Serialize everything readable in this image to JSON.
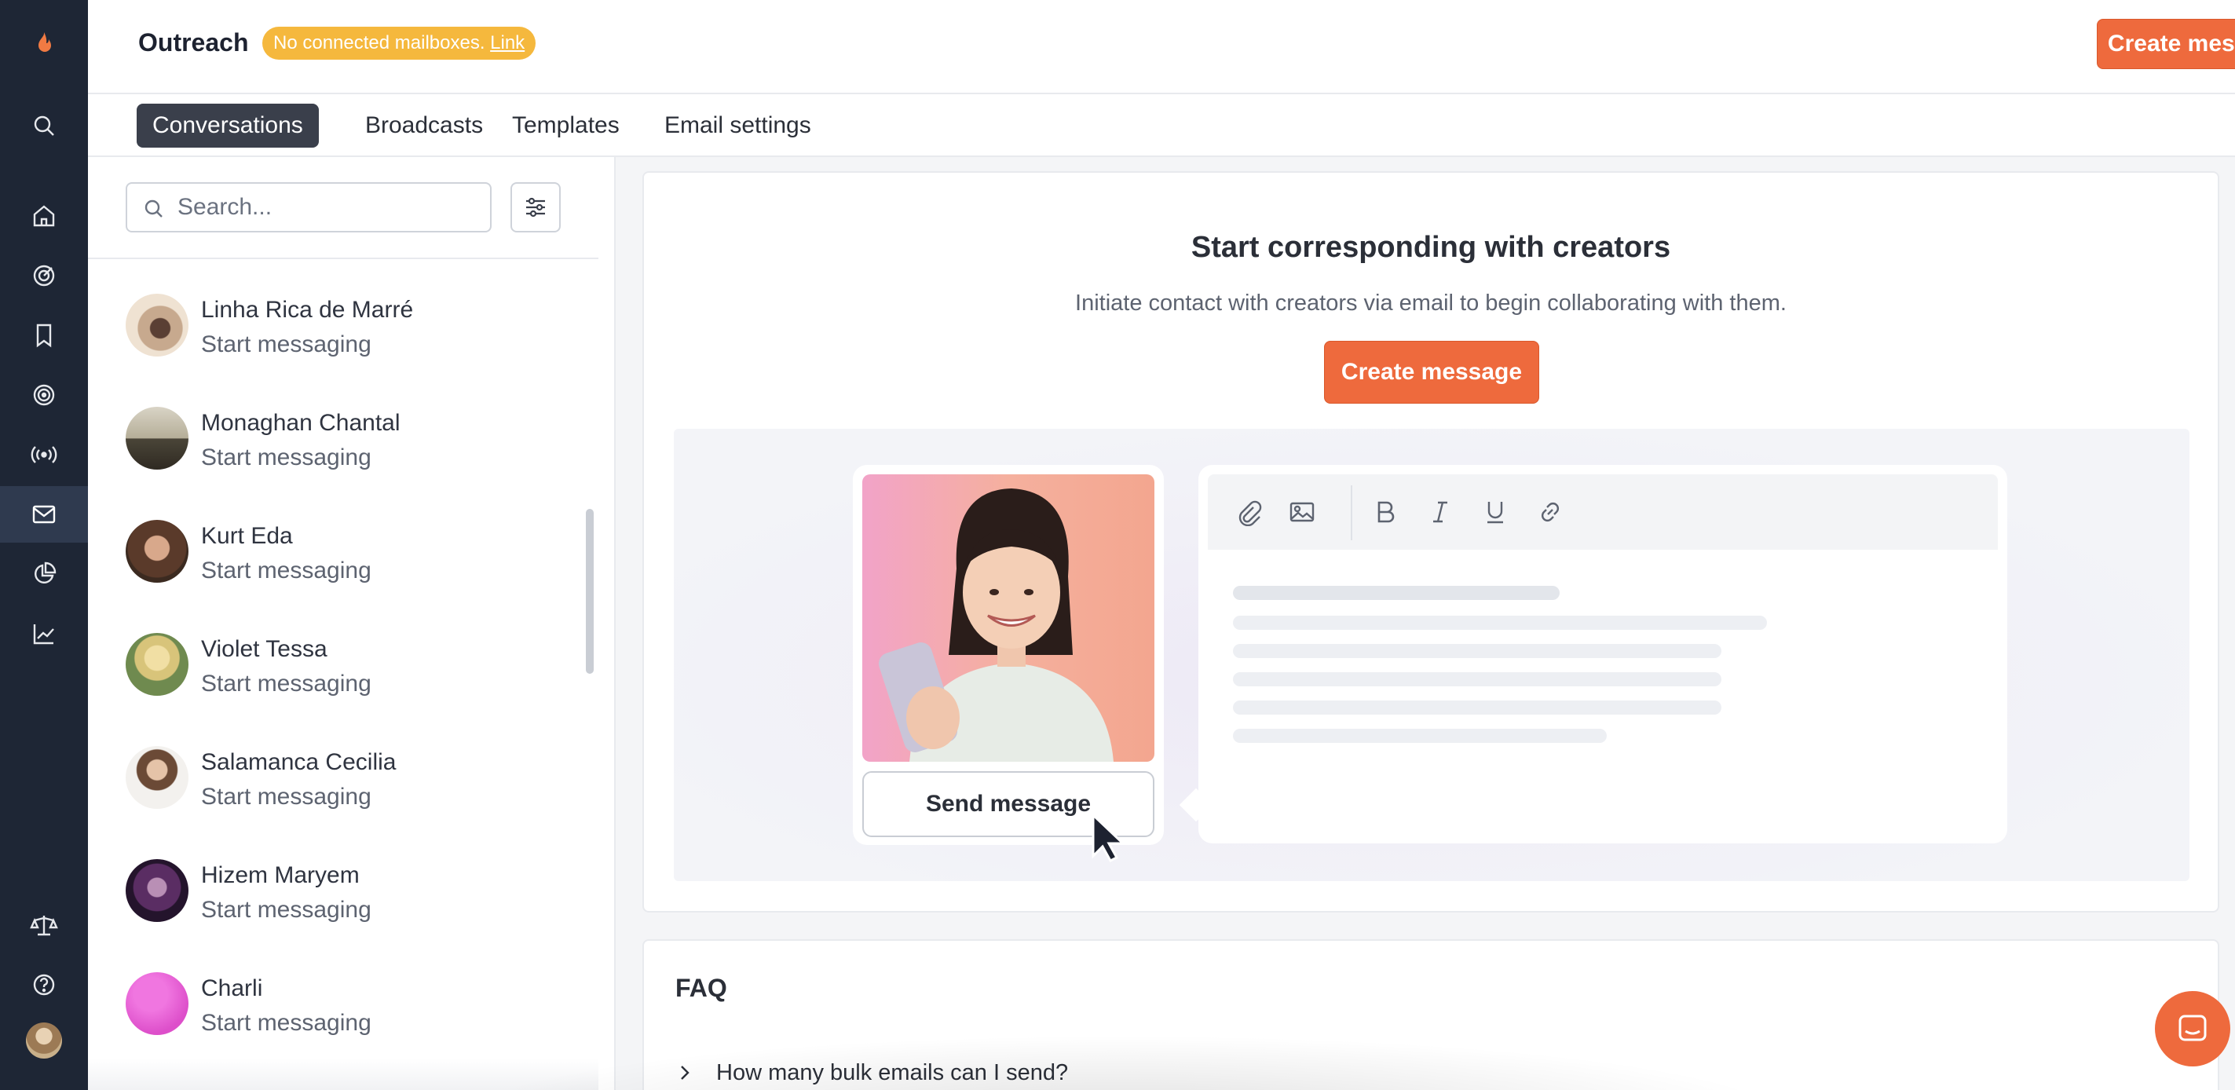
{
  "app": {
    "title": "Outreach",
    "mailbox_notice": "No connected mailboxes.",
    "mailbox_link": "Link",
    "create_button": "Create message"
  },
  "rail": {
    "items": [
      "logo-flame-icon",
      "search-icon",
      "home-icon",
      "target-icon",
      "bookmark-icon",
      "radar-icon",
      "broadcast-icon",
      "mail-icon",
      "pie-chart-icon",
      "trend-chart-icon",
      "scale-icon",
      "help-icon",
      "user-avatar"
    ],
    "active": "mail-icon"
  },
  "tabs": [
    {
      "label": "Conversations",
      "active": true
    },
    {
      "label": "Broadcasts",
      "active": false
    },
    {
      "label": "Templates",
      "active": false
    },
    {
      "label": "Email settings",
      "active": false
    }
  ],
  "search": {
    "placeholder": "Search...",
    "value": ""
  },
  "contacts": [
    {
      "name": "Linha Rica de Marré",
      "status": "Start messaging"
    },
    {
      "name": "Monaghan Chantal",
      "status": "Start messaging"
    },
    {
      "name": "Kurt Eda",
      "status": "Start messaging"
    },
    {
      "name": "Violet Tessa",
      "status": "Start messaging"
    },
    {
      "name": "Salamanca Cecilia",
      "status": "Start messaging"
    },
    {
      "name": "Hizem Maryem",
      "status": "Start messaging"
    },
    {
      "name": "Charli",
      "status": "Start messaging"
    }
  ],
  "empty_state": {
    "title": "Start corresponding with creators",
    "subtitle": "Initiate contact with creators via email to begin collaborating with them.",
    "create_button": "Create message",
    "illustration_button": "Send message"
  },
  "faq": {
    "title": "FAQ",
    "items": [
      "How many bulk emails can I send?"
    ]
  },
  "colors": {
    "accent": "#ee6a3d",
    "rail": "#1e2635",
    "badge": "#f5b83d"
  }
}
